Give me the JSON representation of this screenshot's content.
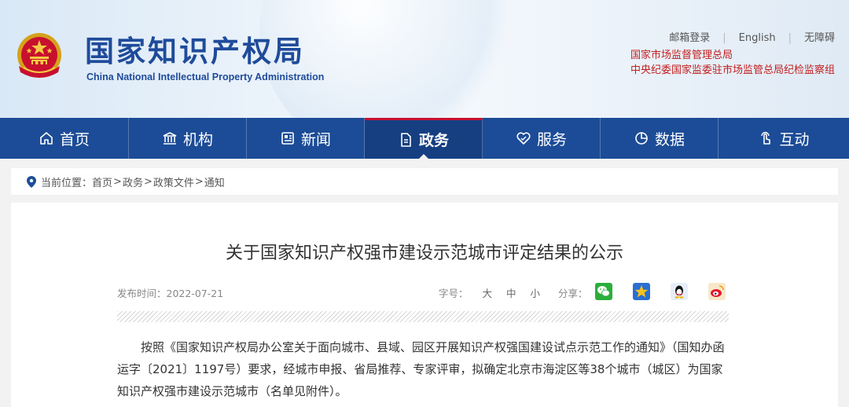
{
  "header": {
    "logo_cn": "国家知识产权局",
    "logo_en": "China National Intellectual Property Administration",
    "top_links": [
      "邮箱登录",
      "English",
      "无障碍"
    ],
    "org_links": [
      "国家市场监督管理总局",
      "中央纪委国家监委驻市场监管总局纪检监察组"
    ]
  },
  "nav": {
    "items": [
      {
        "label": "首页",
        "icon": "home-icon"
      },
      {
        "label": "机构",
        "icon": "institution-icon"
      },
      {
        "label": "新闻",
        "icon": "news-icon"
      },
      {
        "label": "政务",
        "icon": "document-icon",
        "active": true
      },
      {
        "label": "服务",
        "icon": "service-icon"
      },
      {
        "label": "数据",
        "icon": "data-icon"
      },
      {
        "label": "互动",
        "icon": "interaction-icon"
      }
    ],
    "accent_color": "#1c4c97",
    "active_indicator_color": "#c8102e"
  },
  "breadcrumb": {
    "prefix": "当前位置：",
    "items": [
      "首页",
      "政务",
      "政策文件",
      "通知"
    ],
    "separator": ">"
  },
  "article": {
    "title": "关于国家知识产权强市建设示范城市评定结果的公示",
    "date_label": "发布时间：2022-07-21",
    "font_size_label": "字号：",
    "font_sizes": [
      "大",
      "中",
      "小"
    ],
    "share_label": "分享：",
    "share_icons": [
      "wechat-icon",
      "qzone-icon",
      "qq-icon",
      "weibo-icon"
    ],
    "body": "按照《国家知识产权局办公室关于面向城市、县域、园区开展知识产权强国建设试点示范工作的通知》（国知办函运字〔2021〕1197号）要求，经城市申报、省局推荐、专家评审，拟确定北京市海淀区等38个城市（城区）为国家知识产权强市建设示范城市（名单见附件）。"
  }
}
